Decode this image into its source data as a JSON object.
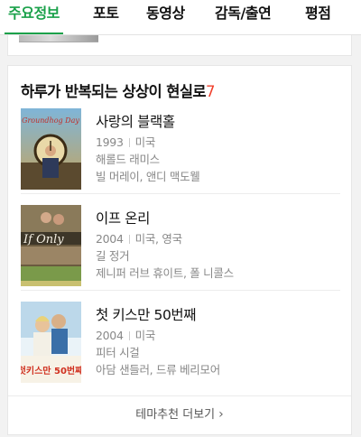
{
  "tabs": [
    {
      "label": "주요정보",
      "active": true
    },
    {
      "label": "포토",
      "active": false
    },
    {
      "label": "동영상",
      "active": false
    },
    {
      "label": "감독/출연",
      "active": false
    },
    {
      "label": "평점",
      "active": false
    }
  ],
  "theme_card": {
    "title": "하루가 반복되는 상상이 현실로",
    "count": "7",
    "movies": [
      {
        "title": "사랑의 블랙홀",
        "year": "1993",
        "country": "미국",
        "director": "해롤드 래미스",
        "cast": "빌 머레이, 앤디 맥도웰",
        "poster_text": "Groundhog Day"
      },
      {
        "title": "이프 온리",
        "year": "2004",
        "country": "미국, 영국",
        "director": "길 정거",
        "cast": "제니퍼 러브 휴이트, 폴 니콜스",
        "poster_text": "If Only"
      },
      {
        "title": "첫 키스만 50번째",
        "year": "2004",
        "country": "미국",
        "director": "피터 시걸",
        "cast": "아담 샌들러, 드류 베리모어",
        "poster_text": "첫키스만 50번째"
      }
    ],
    "more_label": "테마추천 더보기"
  },
  "colors": {
    "accent": "#1aa14a",
    "count": "#f0402c"
  }
}
